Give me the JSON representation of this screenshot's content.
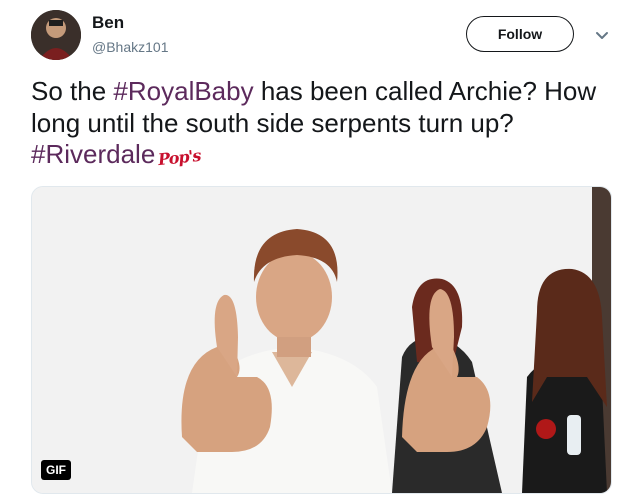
{
  "tweet": {
    "author_name": "Ben",
    "author_handle": "@Bhakz101",
    "follow_label": "Follow",
    "text_before_1": "So the ",
    "hashtag_1": "#RoyalBaby",
    "text_after_1": " has been called Archie? How long until the south side serpents turn up? ",
    "hashtag_2": "#Riverdale",
    "emoji_label": "Pop's",
    "gif_badge": "GIF"
  },
  "colors": {
    "hashtag": "#5c2a5c",
    "text": "#14171a",
    "secondary_text": "#657786",
    "border": "#e1e8ed"
  },
  "icons": {
    "caret": "chevron-down-icon",
    "avatar": "avatar"
  }
}
